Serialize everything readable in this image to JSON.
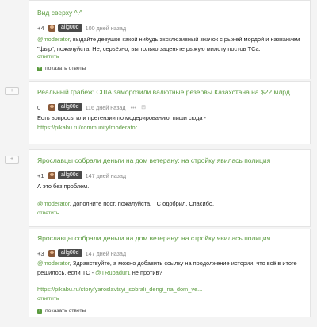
{
  "comments": [
    {
      "title": "Вид сверху ^.^",
      "score": "+4",
      "user": "allg00d",
      "time": "100 дней назад",
      "text_lead": "@moderator",
      "text": ", выдайте девушке какой нибудь эксклюзивный значок с рыжей мордой и названием \"фыр\", пожалуйста. Не, серьёзно, вы только заценяте рыжую милоту постов ТСа.",
      "reply": "ответить",
      "show_replies": "показать ответы"
    },
    {
      "title": "Реальный грабеж: США заморозили валютные резервы Казахстана на $22 млрд.",
      "score": "0",
      "user": "allg00d",
      "time": "116 дней назад",
      "text": "Есть вопросы или претензии по модерированию, пиши сюда -",
      "link": "https://pikabu.ru/community/moderator",
      "reply": "ответить"
    },
    {
      "title": "Ярославцы собрали деньги на дом ветерану: на стройку явилась полиция",
      "score": "+1",
      "user": "allg00d",
      "time": "147 дней назад",
      "text1": "А это без проблем.",
      "text_lead": "@moderator",
      "text2": ", дополните пост, пожалуйста. ТС одобрил. Спасибо.",
      "reply": "ответить"
    },
    {
      "title": "Ярославцы собрали деньги на дом ветерану: на стройку явилась полиция",
      "score": "+3",
      "user": "allg00d",
      "time": "147 дней назад",
      "text_lead": "@moderator",
      "text_a": ", Здравствуйте, а можно добавить ссылку на продолжение истории, что всё в итоге решилось, если ТС - ",
      "mention": "@TRubadur1",
      "text_b": " не против?",
      "link": "https://pikabu.ru/story/yaroslavtsyi_sobrali_dengi_na_dom_ve...",
      "reply": "ответить",
      "show_replies": "показать ответы"
    }
  ],
  "expand_symbol": "+",
  "show_symbol": "+"
}
